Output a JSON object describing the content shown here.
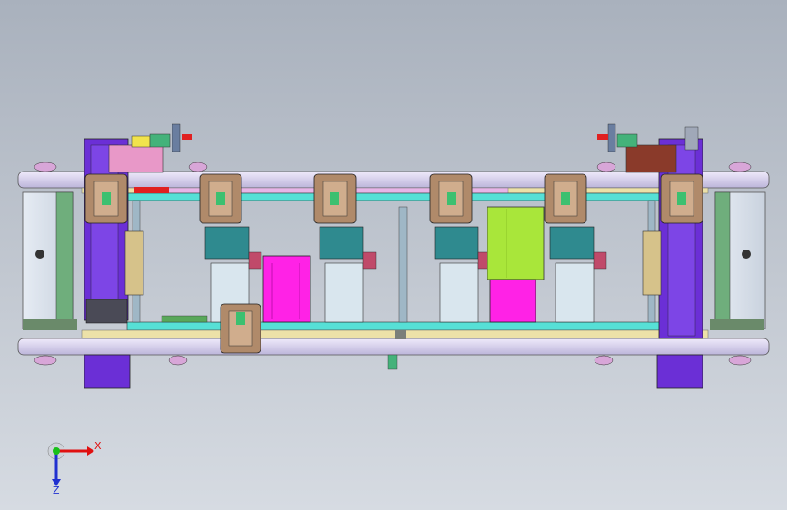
{
  "triad": {
    "x_label": "X",
    "z_label": "Z"
  },
  "colors": {
    "background_top": "#a9b1bd",
    "rail": "#d8d3ef",
    "rail_dark": "#8f8aa9",
    "motor": "#6b2fd6",
    "motor_dark": "#3a1b8a",
    "gripper": "#b08a6a",
    "gripper_face": "#d0ad8d",
    "teal_block": "#2f8a8f",
    "magenta": "#ff22e6",
    "lime": "#a9e63a",
    "cyan_strip": "#56e0d6",
    "red": "#e02020",
    "pale": "#d9e6ee"
  }
}
